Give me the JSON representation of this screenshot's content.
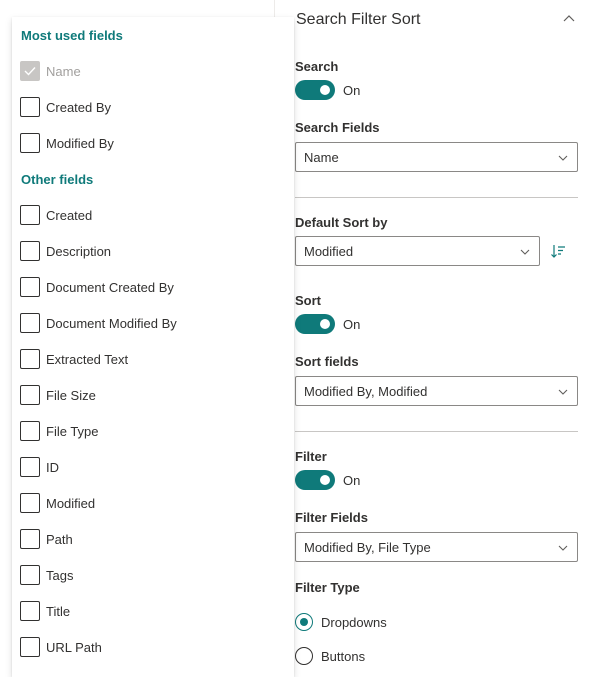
{
  "panel": {
    "title": "Search Filter Sort",
    "search": {
      "label": "Search",
      "toggle_state": "On",
      "fields_label": "Search Fields",
      "fields_value": "Name"
    },
    "sort_by": {
      "label": "Default Sort by",
      "value": "Modified"
    },
    "sort": {
      "label": "Sort",
      "toggle_state": "On",
      "fields_label": "Sort fields",
      "fields_value": "Modified By, Modified"
    },
    "filter": {
      "label": "Filter",
      "toggle_state": "On",
      "fields_label": "Filter Fields",
      "fields_value": "Modified By, File Type",
      "type_label": "Filter Type",
      "options": [
        {
          "label": "Dropdowns",
          "checked": true
        },
        {
          "label": "Buttons",
          "checked": false
        }
      ]
    }
  },
  "field_list": {
    "most_used_header": "Most used fields",
    "most_used": [
      {
        "label": "Name",
        "checked": true,
        "disabled": true
      },
      {
        "label": "Created By",
        "checked": false,
        "disabled": false
      },
      {
        "label": "Modified By",
        "checked": false,
        "disabled": false
      }
    ],
    "other_header": "Other fields",
    "other": [
      {
        "label": "Created"
      },
      {
        "label": "Description"
      },
      {
        "label": "Document Created By"
      },
      {
        "label": "Document Modified By"
      },
      {
        "label": "Extracted Text"
      },
      {
        "label": "File Size"
      },
      {
        "label": "File Type"
      },
      {
        "label": "ID"
      },
      {
        "label": "Modified"
      },
      {
        "label": "Path"
      },
      {
        "label": "Tags"
      },
      {
        "label": "Title"
      },
      {
        "label": "URL Path"
      }
    ]
  },
  "colors": {
    "accent": "#0f7a7a",
    "text": "#323130",
    "border": "#8a8886",
    "disabled": "#a19f9d"
  }
}
